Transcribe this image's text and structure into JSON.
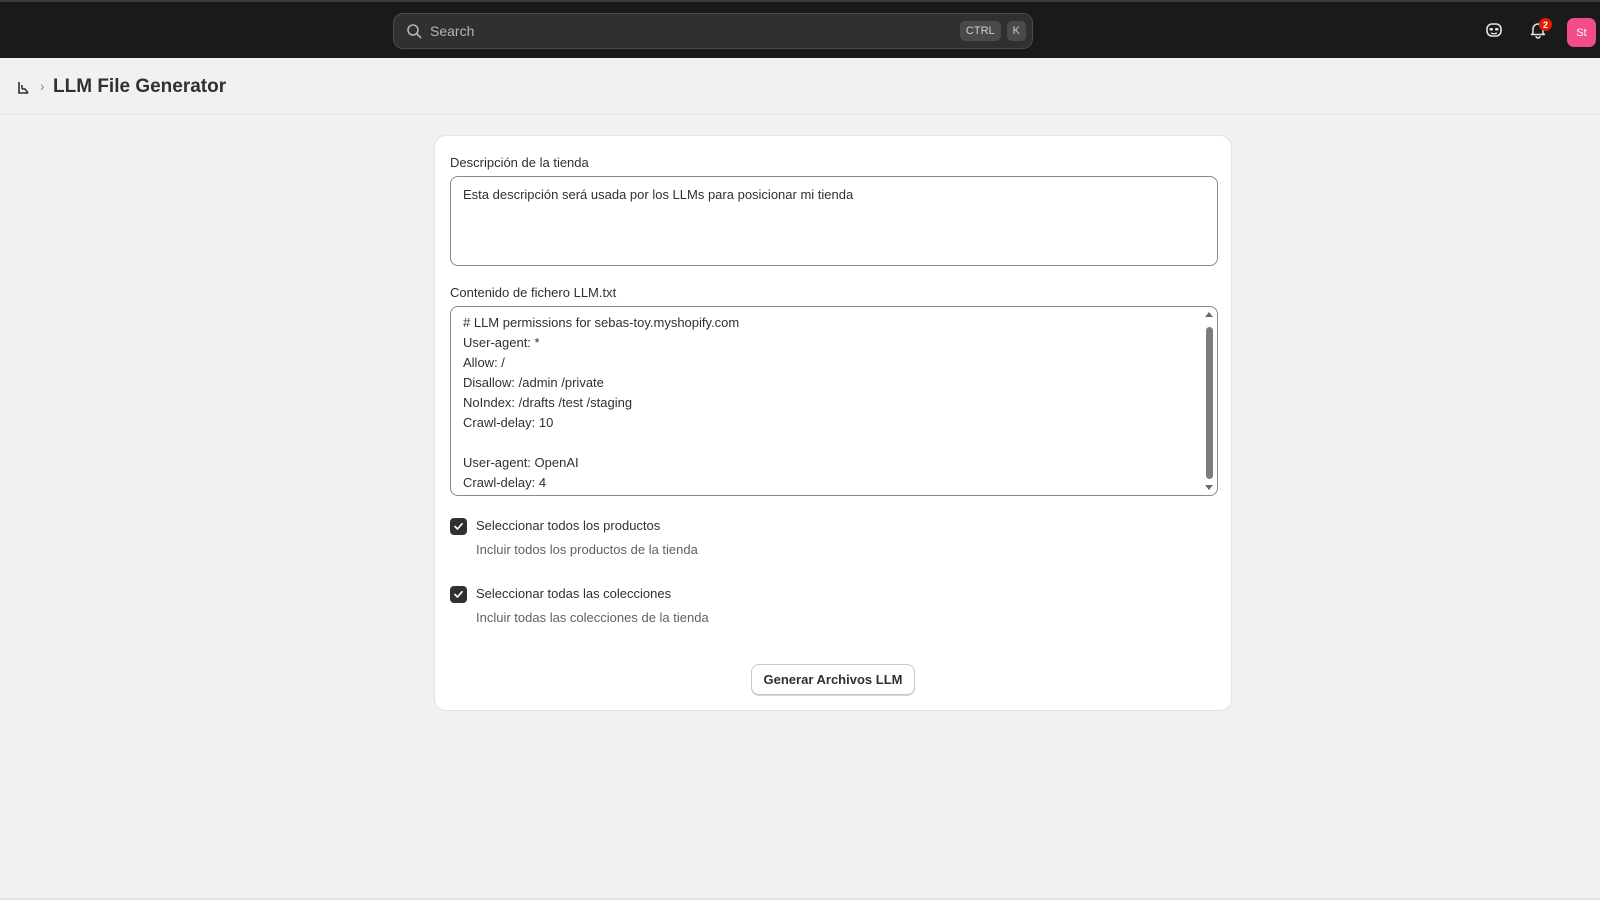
{
  "topbar": {
    "search_placeholder": "Search",
    "shortcut_key1": "CTRL",
    "shortcut_key2": "K",
    "notification_count": "2",
    "avatar_initials": "St"
  },
  "header": {
    "title": "LLM File Generator"
  },
  "form": {
    "description_label": "Descripción de la tienda",
    "description_value": "Esta descripción será usada por los LLMs para posicionar mi tienda",
    "llm_label": "Contenido de fichero LLM.txt",
    "llm_lines": [
      "# LLM permissions for sebas-toy.myshopify.com",
      "User-agent: *",
      "Allow: /",
      "Disallow: /admin /private",
      "NoIndex: /drafts /test /staging",
      "Crawl-delay: 10",
      "",
      "User-agent: OpenAI",
      "Crawl-delay: 4"
    ],
    "products_checkbox": {
      "label": "Seleccionar todos los productos",
      "help": "Incluir todos los productos de la tienda",
      "checked": true
    },
    "collections_checkbox": {
      "label": "Seleccionar todas las colecciones",
      "help": "Incluir todas las colecciones de la tienda",
      "checked": true
    },
    "submit_label": "Generar Archivos LLM"
  },
  "colors": {
    "topbar_bg": "#1a1a1a",
    "page_bg": "#f1f1f1",
    "avatar_bg": "#f24c8c",
    "badge_bg": "#e51c00"
  }
}
